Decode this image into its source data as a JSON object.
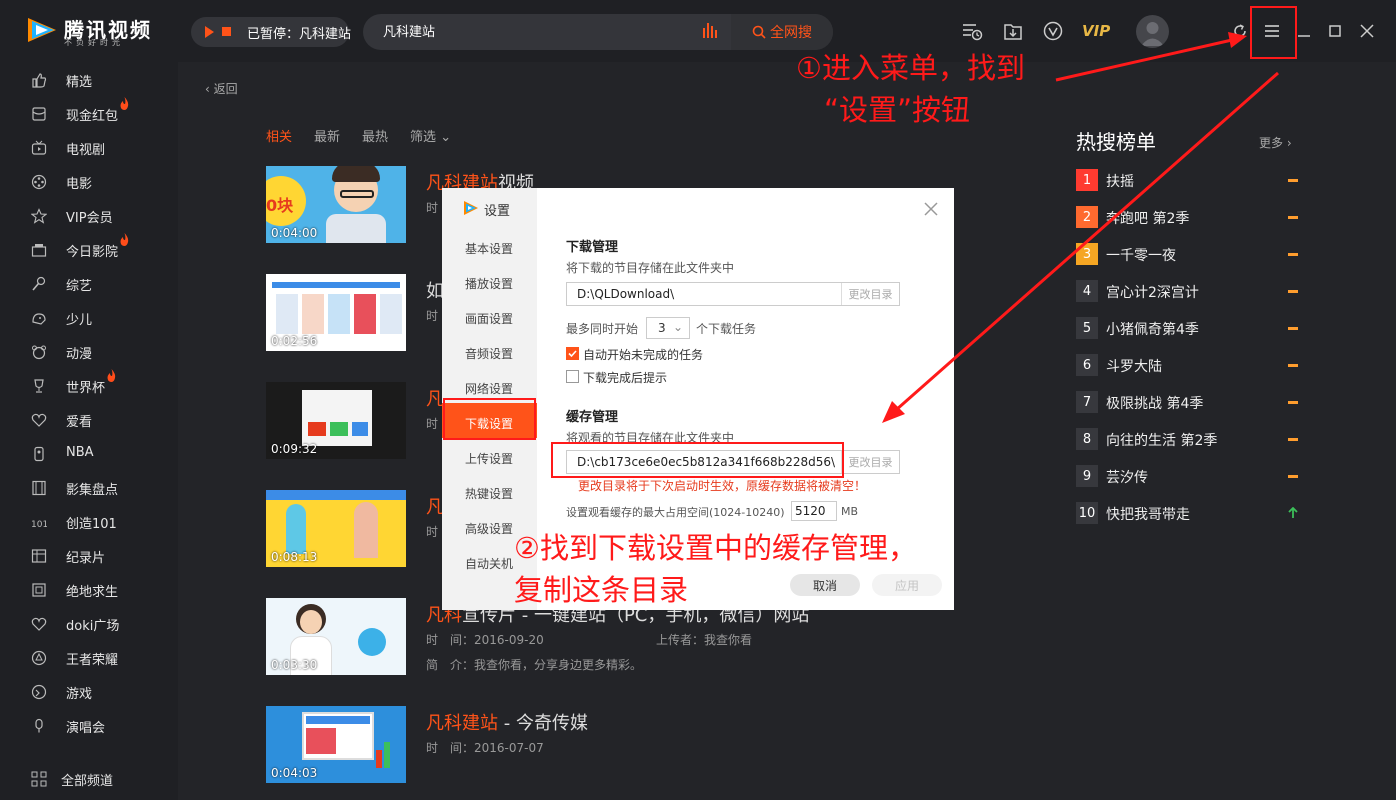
{
  "app": {
    "brand": "腾讯视频",
    "slogan": "不负好时光"
  },
  "player": {
    "status": "已暂停：凡科建站"
  },
  "search": {
    "value": "凡科建站",
    "button": "全网搜"
  },
  "toolbar": {
    "vip": "VIP"
  },
  "sidebar": {
    "items": [
      {
        "label": "精选",
        "icon": "thumbs-up-icon"
      },
      {
        "label": "现金红包",
        "icon": "red-packet-icon",
        "hot": true
      },
      {
        "label": "电视剧",
        "icon": "tv-icon"
      },
      {
        "label": "电影",
        "icon": "film-reel-icon"
      },
      {
        "label": "VIP会员",
        "icon": "star-icon"
      },
      {
        "label": "今日影院",
        "icon": "cinema-icon",
        "hot": true
      },
      {
        "label": "综艺",
        "icon": "microphone-icon"
      },
      {
        "label": "少儿",
        "icon": "kids-icon"
      },
      {
        "label": "动漫",
        "icon": "anime-icon"
      },
      {
        "label": "世界杯",
        "icon": "trophy-icon",
        "hot": true
      },
      {
        "label": "爱看",
        "icon": "heart-icon"
      },
      {
        "label": "NBA",
        "icon": "nba-icon"
      },
      {
        "label": "影集盘点",
        "icon": "film-strip-icon"
      },
      {
        "label": "创造101",
        "icon": "create-icon"
      },
      {
        "label": "纪录片",
        "icon": "documentary-icon"
      },
      {
        "label": "绝地求生",
        "icon": "game-pubg-icon"
      },
      {
        "label": "doki广场",
        "icon": "doki-icon"
      },
      {
        "label": "王者荣耀",
        "icon": "kings-icon"
      },
      {
        "label": "游戏",
        "icon": "gamepad-icon"
      },
      {
        "label": "演唱会",
        "icon": "concert-icon"
      }
    ],
    "all_channels": "全部频道"
  },
  "nav": {
    "back": "返回"
  },
  "filters": [
    "相关",
    "最新",
    "最热",
    "筛选"
  ],
  "results": [
    {
      "title_hl": "凡科建站",
      "title_rest": "视频",
      "meta": "时",
      "duration": "0:04:00"
    },
    {
      "title_hl": "",
      "title_rest": "如",
      "meta": "时",
      "duration": "0:02:56"
    },
    {
      "title_hl": "凡",
      "title_rest": "",
      "meta": "时",
      "duration": "0:09:32"
    },
    {
      "title_hl": "凡",
      "title_rest": "",
      "meta": "时",
      "duration": "0:08:13"
    },
    {
      "title_hl": "凡科",
      "title_rest": "宣传片 - 一键建站（PC，手机，微信）网站",
      "meta": "时　间：2016-09-20",
      "uploader": "上传者：我查你看",
      "intro": "简　介：我查你看，分享身边更多精彩。",
      "duration": "0:03:30"
    },
    {
      "title_hl": "凡科建站",
      "title_rest": " - 今奇传媒",
      "meta": "时　间：2016-07-07",
      "duration": "0:04:03"
    }
  ],
  "hot": {
    "title": "热搜榜单",
    "more": "更多",
    "items": [
      {
        "rank": "1",
        "name": "扶摇",
        "trend": "flat",
        "color": "#ff3b30"
      },
      {
        "rank": "2",
        "name": "奔跑吧 第2季",
        "trend": "flat",
        "color": "#ff6a2f"
      },
      {
        "rank": "3",
        "name": "一千零一夜",
        "trend": "flat",
        "color": "#f5a623"
      },
      {
        "rank": "4",
        "name": "宫心计2深宫计",
        "trend": "flat"
      },
      {
        "rank": "5",
        "name": "小猪佩奇第4季",
        "trend": "flat"
      },
      {
        "rank": "6",
        "name": "斗罗大陆",
        "trend": "flat"
      },
      {
        "rank": "7",
        "name": "极限挑战 第4季",
        "trend": "flat"
      },
      {
        "rank": "8",
        "name": "向往的生活 第2季",
        "trend": "flat"
      },
      {
        "rank": "9",
        "name": "芸汐传",
        "trend": "flat"
      },
      {
        "rank": "10",
        "name": "快把我哥带走",
        "trend": "up"
      }
    ]
  },
  "dialog": {
    "title": "设置",
    "tabs": [
      "基本设置",
      "播放设置",
      "画面设置",
      "音频设置",
      "网络设置",
      "下载设置",
      "上传设置",
      "热键设置",
      "高级设置",
      "自动关机"
    ],
    "active_tab": "下载设置",
    "download": {
      "title": "下载管理",
      "desc": "将下载的节目存储在此文件夹中",
      "path": "D:\\QLDownload\\",
      "change": "更改目录",
      "max_prefix": "最多同时开始",
      "max_value": "3",
      "max_suffix": "个下载任务",
      "auto_start": "自动开始未完成的任务",
      "notify": "下载完成后提示"
    },
    "cache": {
      "title": "缓存管理",
      "desc": "将观看的节目存储在此文件夹中",
      "path": "D:\\cb173ce6e0ec5b812a341f668b228d56\\",
      "change": "更改目录",
      "warning": "更改目录将于下次启动时生效，原缓存数据将被清空！",
      "size_label": "设置观看缓存的最大占用空间(1024-10240)",
      "size_value": "5120",
      "size_unit": "MB"
    },
    "cancel": "取消",
    "apply": "应用"
  },
  "annotations": {
    "step1_line1": "①进入菜单，找到",
    "step1_line2": "“设置”按钮",
    "step2_line1": "②找到下载设置中的缓存管理，",
    "step2_line2": "复制这条目录"
  },
  "colors": {
    "accent": "#ff5319",
    "annotation": "#ff1a1a",
    "vip": "#e8b846"
  }
}
